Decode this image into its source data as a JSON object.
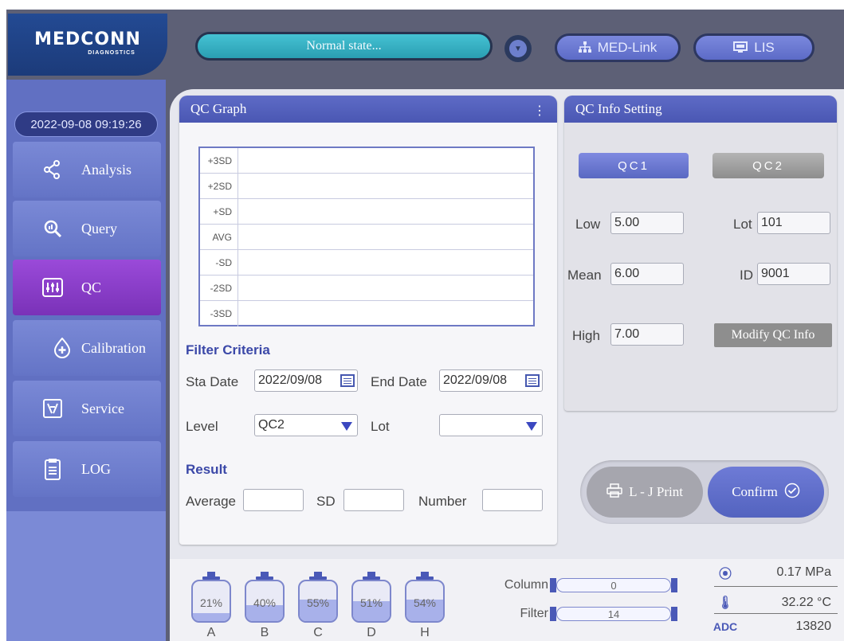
{
  "brand": {
    "name": "MEDCONN",
    "subtitle": "DIAGNOSTICS"
  },
  "header": {
    "status_text": "Normal state...",
    "buttons": [
      {
        "label": "MED-Link",
        "icon": "network-icon"
      },
      {
        "label": "LIS",
        "icon": "monitor-icon"
      }
    ]
  },
  "datetime": "2022-09-08 09:19:26",
  "sidebar": {
    "items": [
      {
        "label": "Analysis",
        "icon": "molecule-icon",
        "active": false
      },
      {
        "label": "Query",
        "icon": "magnifier-icon",
        "active": false
      },
      {
        "label": "QC",
        "icon": "sliders-icon",
        "active": true
      },
      {
        "label": "Calibration",
        "icon": "plus-drop-icon",
        "active": false
      },
      {
        "label": "Service",
        "icon": "wrench-icon",
        "active": false
      },
      {
        "label": "LOG",
        "icon": "clipboard-icon",
        "active": false
      }
    ]
  },
  "qc_graph": {
    "title": "QC Graph",
    "levels": [
      "+3SD",
      "+2SD",
      "+SD",
      "AVG",
      "-SD",
      "-2SD",
      "-3SD"
    ]
  },
  "filter": {
    "title": "Filter Criteria",
    "sta_date_label": "Sta Date",
    "sta_date": "2022/09/08",
    "end_date_label": "End Date",
    "end_date": "2022/09/08",
    "level_label": "Level",
    "level": "QC2",
    "lot_label": "Lot",
    "lot": ""
  },
  "result": {
    "title": "Result",
    "average_label": "Average",
    "average": "",
    "sd_label": "SD",
    "sd": "",
    "number_label": "Number",
    "number": ""
  },
  "qc_info": {
    "title": "QC Info Setting",
    "tabs": [
      "QC1",
      "QC2"
    ],
    "low_label": "Low",
    "low": "5.00",
    "lot_label": "Lot",
    "lot": "101",
    "mean_label": "Mean",
    "mean": "6.00",
    "id_label": "ID",
    "id": "9001",
    "high_label": "High",
    "high": "7.00",
    "modify_label": "Modify QC Info"
  },
  "actions": {
    "print_label": "L - J Print",
    "confirm_label": "Confirm"
  },
  "reagents": [
    {
      "letter": "A",
      "pct": "21%",
      "level": 0.21
    },
    {
      "letter": "B",
      "pct": "40%",
      "level": 0.4
    },
    {
      "letter": "C",
      "pct": "55%",
      "level": 0.55
    },
    {
      "letter": "D",
      "pct": "51%",
      "level": 0.51
    },
    {
      "letter": "H",
      "pct": "54%",
      "level": 0.54
    }
  ],
  "meters": {
    "column_label": "Column",
    "column_value": "0",
    "filter_label": "Filter",
    "filter_value": "14"
  },
  "sensors": {
    "pressure": "0.17 MPa",
    "temperature": "32.22 °C",
    "adc_label": "ADC",
    "adc": "13820"
  },
  "colors": {
    "accent": "#5363bf",
    "active_nav": "#8a3fd0",
    "status": "#3bb3c7"
  }
}
